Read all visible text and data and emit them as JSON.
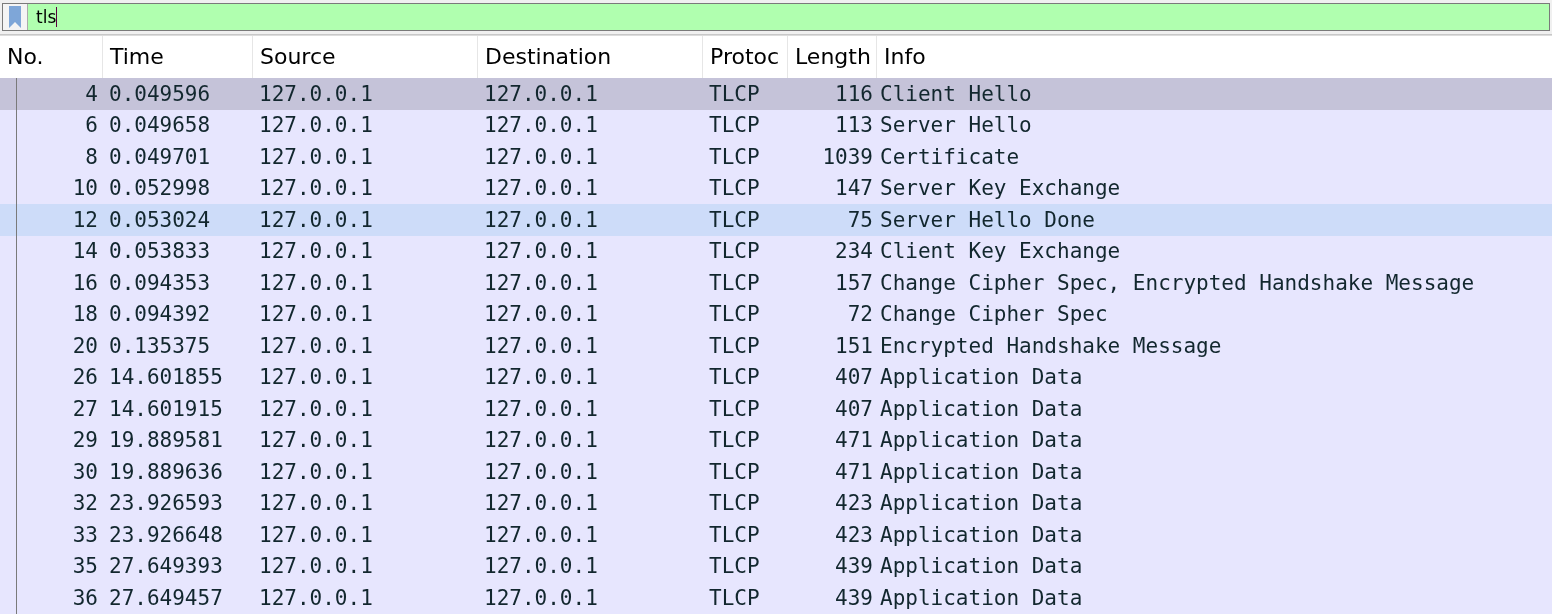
{
  "filter": {
    "value": "tls"
  },
  "table": {
    "columns": [
      "No.",
      "Time",
      "Source",
      "Destination",
      "Protoc",
      "Length",
      "Info"
    ],
    "rows": [
      {
        "cells": [
          "4",
          "0.049596",
          "127.0.0.1",
          "127.0.0.1",
          "TLCP",
          "116",
          "Client Hello"
        ],
        "selected": true,
        "hovered": false
      },
      {
        "cells": [
          "6",
          "0.049658",
          "127.0.0.1",
          "127.0.0.1",
          "TLCP",
          "113",
          "Server Hello"
        ],
        "selected": false,
        "hovered": false
      },
      {
        "cells": [
          "8",
          "0.049701",
          "127.0.0.1",
          "127.0.0.1",
          "TLCP",
          "1039",
          "Certificate"
        ],
        "selected": false,
        "hovered": false
      },
      {
        "cells": [
          "10",
          "0.052998",
          "127.0.0.1",
          "127.0.0.1",
          "TLCP",
          "147",
          "Server Key Exchange"
        ],
        "selected": false,
        "hovered": false
      },
      {
        "cells": [
          "12",
          "0.053024",
          "127.0.0.1",
          "127.0.0.1",
          "TLCP",
          "75",
          "Server Hello Done"
        ],
        "selected": false,
        "hovered": true
      },
      {
        "cells": [
          "14",
          "0.053833",
          "127.0.0.1",
          "127.0.0.1",
          "TLCP",
          "234",
          "Client Key Exchange"
        ],
        "selected": false,
        "hovered": false
      },
      {
        "cells": [
          "16",
          "0.094353",
          "127.0.0.1",
          "127.0.0.1",
          "TLCP",
          "157",
          "Change Cipher Spec, Encrypted Handshake Message"
        ],
        "selected": false,
        "hovered": false
      },
      {
        "cells": [
          "18",
          "0.094392",
          "127.0.0.1",
          "127.0.0.1",
          "TLCP",
          "72",
          "Change Cipher Spec"
        ],
        "selected": false,
        "hovered": false
      },
      {
        "cells": [
          "20",
          "0.135375",
          "127.0.0.1",
          "127.0.0.1",
          "TLCP",
          "151",
          "Encrypted Handshake Message"
        ],
        "selected": false,
        "hovered": false
      },
      {
        "cells": [
          "26",
          "14.601855",
          "127.0.0.1",
          "127.0.0.1",
          "TLCP",
          "407",
          "Application Data"
        ],
        "selected": false,
        "hovered": false
      },
      {
        "cells": [
          "27",
          "14.601915",
          "127.0.0.1",
          "127.0.0.1",
          "TLCP",
          "407",
          "Application Data"
        ],
        "selected": false,
        "hovered": false
      },
      {
        "cells": [
          "29",
          "19.889581",
          "127.0.0.1",
          "127.0.0.1",
          "TLCP",
          "471",
          "Application Data"
        ],
        "selected": false,
        "hovered": false
      },
      {
        "cells": [
          "30",
          "19.889636",
          "127.0.0.1",
          "127.0.0.1",
          "TLCP",
          "471",
          "Application Data"
        ],
        "selected": false,
        "hovered": false
      },
      {
        "cells": [
          "32",
          "23.926593",
          "127.0.0.1",
          "127.0.0.1",
          "TLCP",
          "423",
          "Application Data"
        ],
        "selected": false,
        "hovered": false
      },
      {
        "cells": [
          "33",
          "23.926648",
          "127.0.0.1",
          "127.0.0.1",
          "TLCP",
          "423",
          "Application Data"
        ],
        "selected": false,
        "hovered": false
      },
      {
        "cells": [
          "35",
          "27.649393",
          "127.0.0.1",
          "127.0.0.1",
          "TLCP",
          "439",
          "Application Data"
        ],
        "selected": false,
        "hovered": false
      },
      {
        "cells": [
          "36",
          "27.649457",
          "127.0.0.1",
          "127.0.0.1",
          "TLCP",
          "439",
          "Application Data"
        ],
        "selected": false,
        "hovered": false
      }
    ]
  }
}
